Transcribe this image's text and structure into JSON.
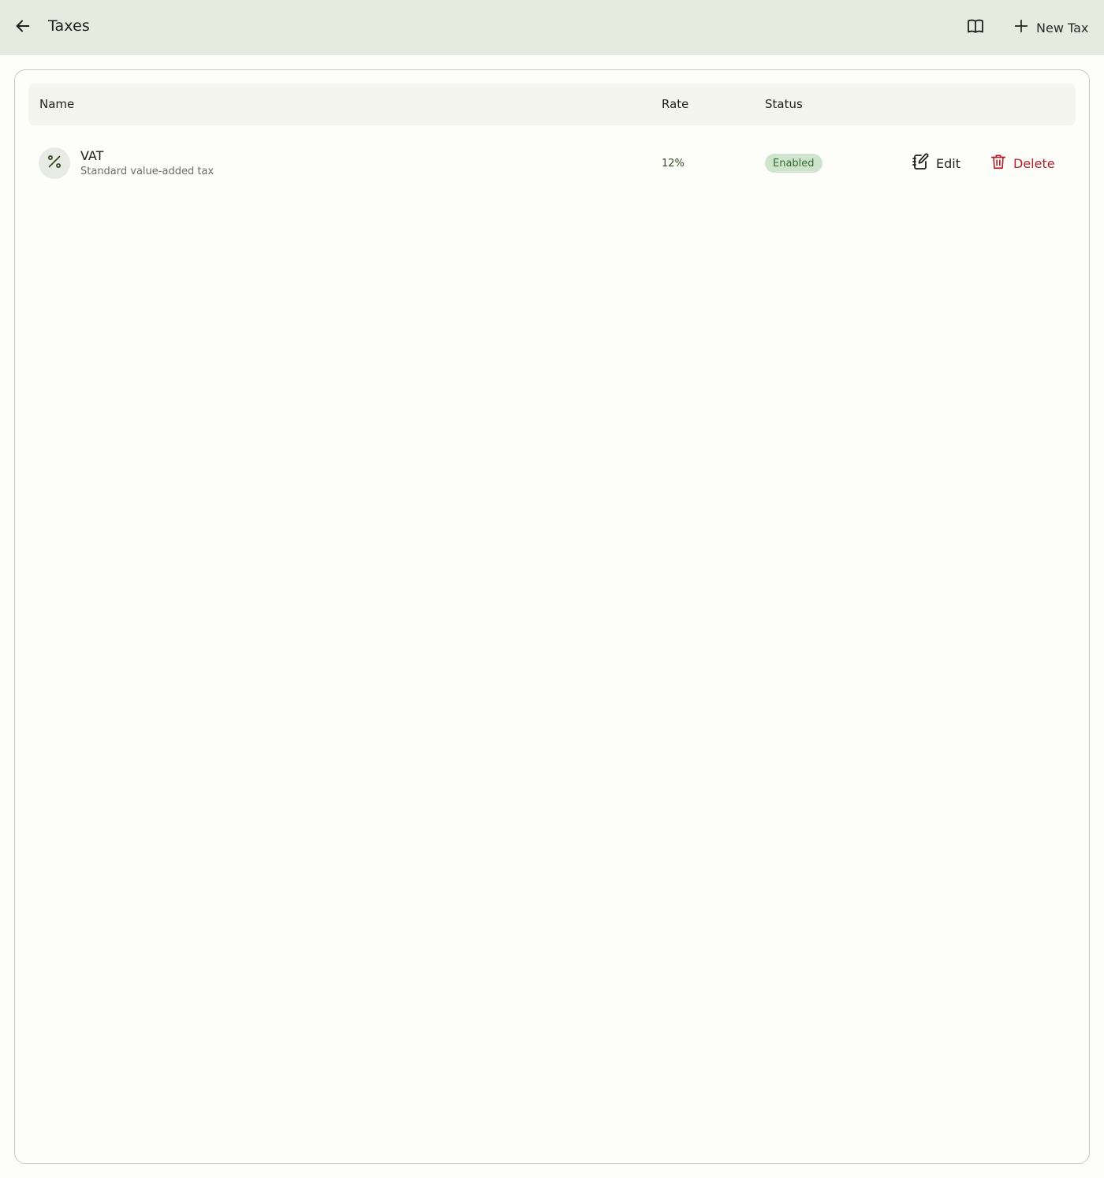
{
  "header": {
    "back_icon": "arrow-left-icon",
    "title": "Taxes",
    "docs_icon": "book-icon",
    "new_button_icon": "plus-icon",
    "new_button_label": "New Tax",
    "background": "#e6ebdf"
  },
  "table": {
    "columns": [
      "Name",
      "Rate",
      "Status"
    ],
    "rows": [
      {
        "icon": "percent-icon",
        "name": "VAT",
        "description": "Standard value-added tax",
        "rate": "12%",
        "status": "Enabled",
        "edit_icon": "edit-icon",
        "edit_label": "Edit",
        "delete_icon": "trash-icon",
        "delete_label": "Delete"
      }
    ]
  },
  "colors": {
    "accent_green": "#2f6b2f",
    "badge_bg": "#cfe4cc",
    "danger": "#b3202a"
  }
}
